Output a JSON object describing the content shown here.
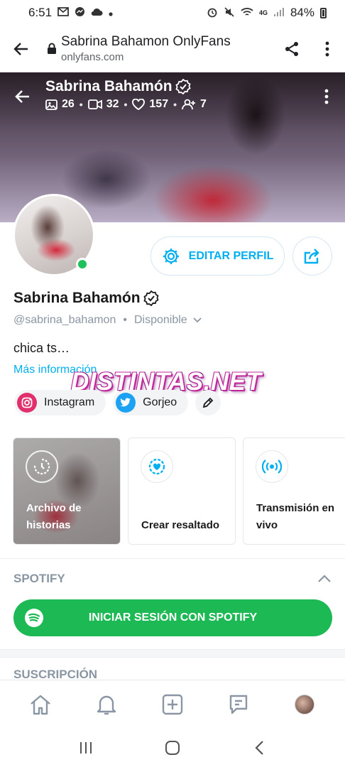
{
  "status_bar": {
    "time": "6:51",
    "battery": "84%",
    "network": "4G"
  },
  "browser": {
    "title": "Sabrina Bahamon OnlyFans",
    "url": "onlyfans.com"
  },
  "cover": {
    "name": "Sabrina Bahamón",
    "stats": {
      "photos": "26",
      "videos": "32",
      "likes": "157",
      "fans": "7"
    }
  },
  "profile": {
    "edit_label": "EDITAR PERFIL",
    "name": "Sabrina Bahamón",
    "handle": "@sabrina_bahamon",
    "status": "Disponible",
    "bio": "chica ts…",
    "more_info": "Más información"
  },
  "watermark": "DISTINTAS.NET",
  "socials": [
    {
      "label": "Instagram"
    },
    {
      "label": "Gorjeo"
    }
  ],
  "highlights": [
    {
      "label": "Archivo de historias"
    },
    {
      "label": "Crear resaltado"
    },
    {
      "label": "Transmisión en vivo"
    }
  ],
  "spotify": {
    "title": "SPOTIFY",
    "button": "INICIAR SESIÓN CON SPOTIFY"
  },
  "subscription": {
    "title": "SUSCRIPCIÓN"
  },
  "colors": {
    "accent": "#00aff0",
    "spotify": "#1db954",
    "online": "#1ec05a",
    "muted": "#8a96a3"
  }
}
